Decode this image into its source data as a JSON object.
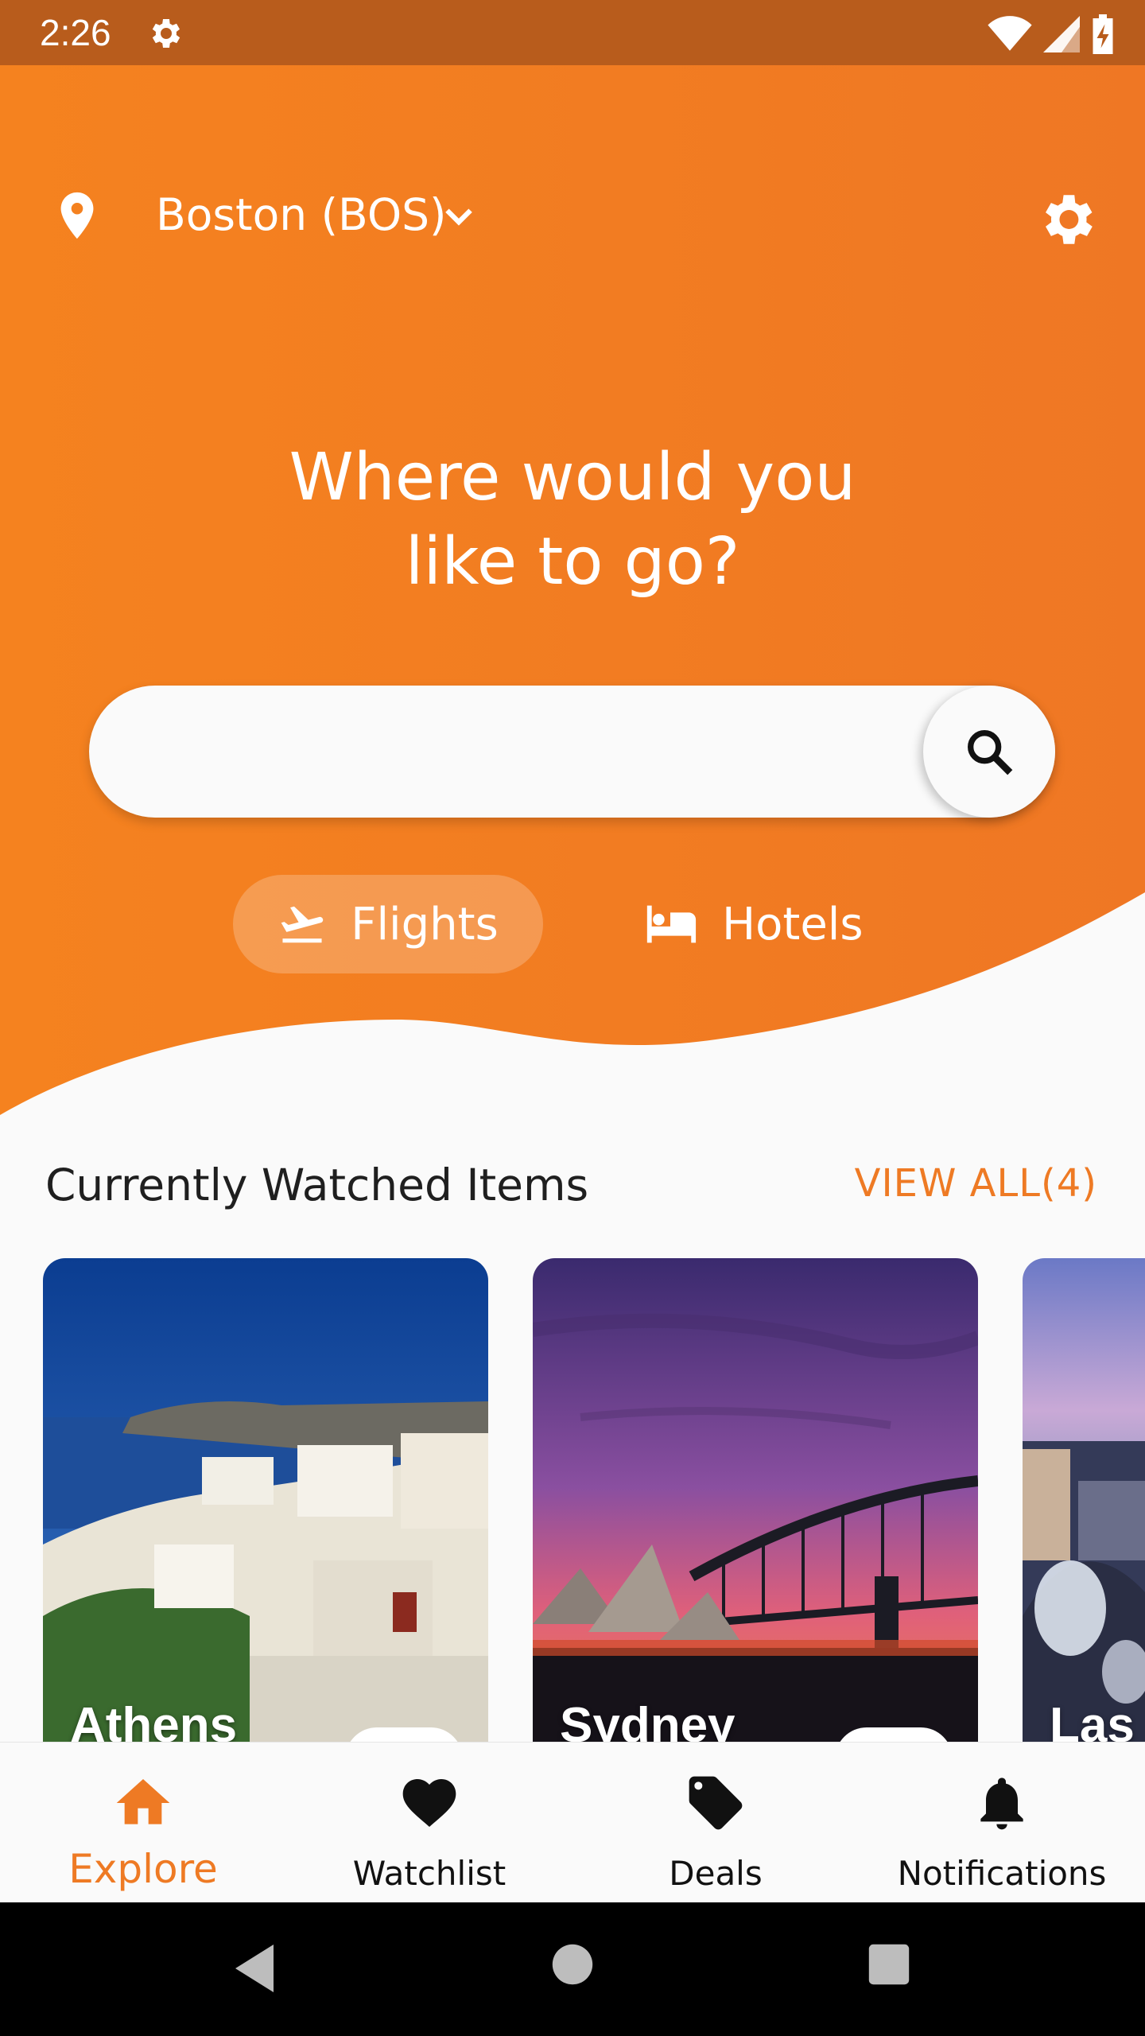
{
  "status_bar": {
    "time": "2:26"
  },
  "header": {
    "location": "Boston (BOS)",
    "headline_line1": "Where would you",
    "headline_line2": "like to go?",
    "search_placeholder": ""
  },
  "tabs": [
    {
      "label": "Flights",
      "icon": "flight-takeoff-icon",
      "selected": true
    },
    {
      "label": "Hotels",
      "icon": "bed-icon",
      "selected": false
    }
  ],
  "watched": {
    "title": "Currently Watched Items",
    "view_all": "VIEW ALL(4)",
    "cards": [
      {
        "title": "Athens"
      },
      {
        "title": "Sydney"
      },
      {
        "title": "Las V"
      }
    ]
  },
  "bottom_nav": [
    {
      "label": "Explore",
      "icon": "home-icon",
      "active": true
    },
    {
      "label": "Watchlist",
      "icon": "heart-icon",
      "active": false
    },
    {
      "label": "Deals",
      "icon": "tag-icon",
      "active": false
    },
    {
      "label": "Notifications",
      "icon": "bell-icon",
      "active": false
    }
  ],
  "colors": {
    "accent": "#ee7a24",
    "status_bar": "#b85c1c"
  }
}
